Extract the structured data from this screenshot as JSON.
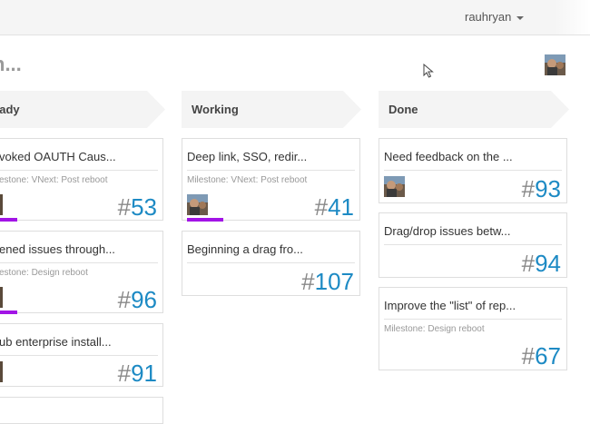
{
  "header": {
    "username": "rauhryan"
  },
  "search": {
    "text": "h..."
  },
  "colors": {
    "accent": "#1d8ac4",
    "progress": "#a214e6"
  },
  "columns": [
    {
      "name": "ready",
      "label": "eady",
      "cards": [
        {
          "title": "voked OAUTH Caus...",
          "milestone": "estone: VNext: Post reboot",
          "number": "53",
          "has_avatar": true,
          "progress": true
        },
        {
          "title": "ened issues through...",
          "milestone": "estone: Design reboot",
          "number": "96",
          "has_avatar": true,
          "progress": true
        },
        {
          "title": "ub enterprise install...",
          "milestone": "",
          "number": "91",
          "has_avatar": true,
          "progress": false
        }
      ]
    },
    {
      "name": "working",
      "label": "Working",
      "cards": [
        {
          "title": "Deep link, SSO, redir...",
          "milestone": "Milestone: VNext: Post reboot",
          "number": "41",
          "has_avatar": true,
          "progress": true
        },
        {
          "title": "Beginning a drag fro...",
          "milestone": "",
          "number": "107",
          "has_avatar": false,
          "progress": false
        }
      ]
    },
    {
      "name": "done",
      "label": "Done",
      "cards": [
        {
          "title": "Need feedback on the ...",
          "milestone": "",
          "number": "93",
          "has_avatar": true,
          "progress": false
        },
        {
          "title": "Drag/drop issues betw...",
          "milestone": "",
          "number": "94",
          "has_avatar": false,
          "progress": false
        },
        {
          "title": "Improve the \"list\" of rep...",
          "milestone": "Milestone: Design reboot",
          "number": "67",
          "has_avatar": false,
          "progress": false
        }
      ]
    }
  ]
}
